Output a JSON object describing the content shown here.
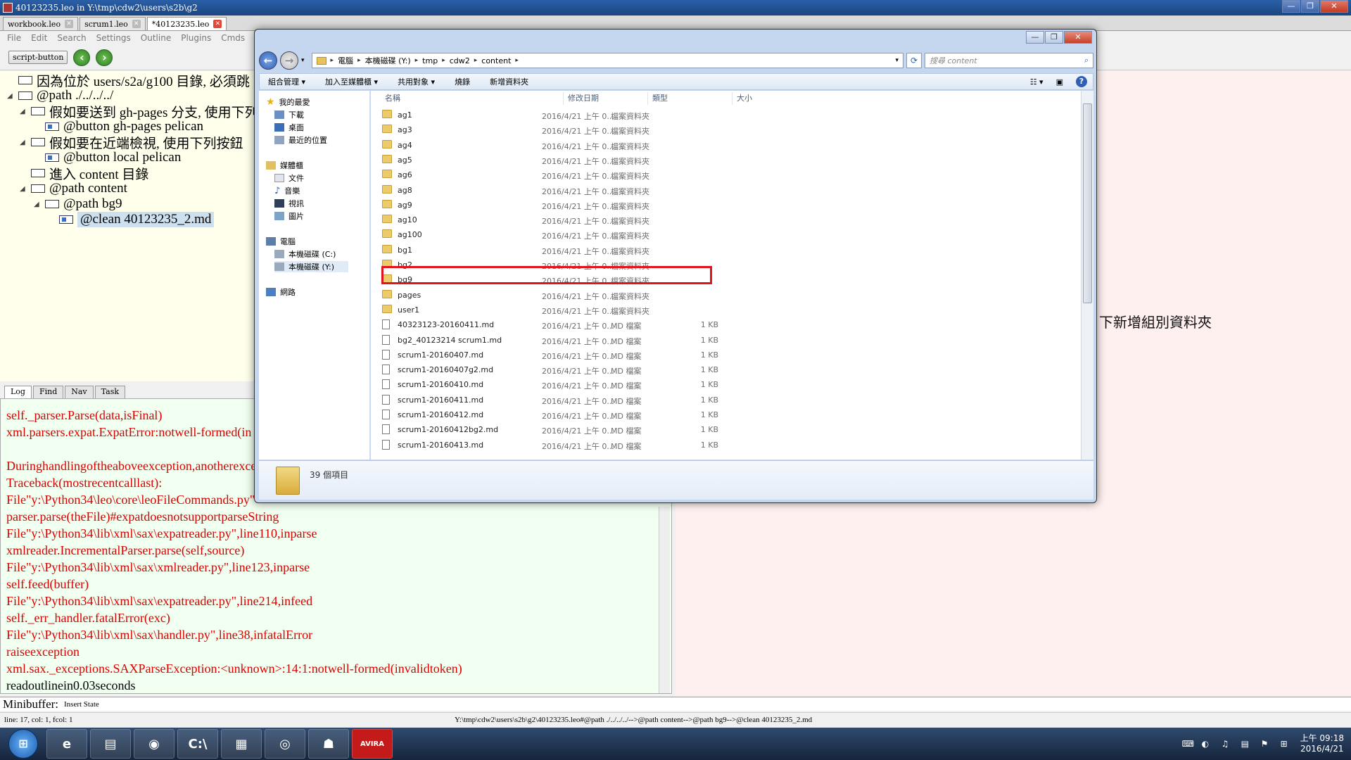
{
  "leo": {
    "title": "40123235.leo in Y:\\tmp\\cdw2\\users\\s2b\\g2",
    "tabs": [
      {
        "label": "workbook.leo",
        "close": "✕"
      },
      {
        "label": "scrum1.leo",
        "close": "✕"
      },
      {
        "label": "*40123235.leo",
        "close": "✕"
      }
    ],
    "menu": [
      "File",
      "Edit",
      "Search",
      "Settings",
      "Outline",
      "Plugins",
      "Cmds"
    ],
    "script_button": "script-button",
    "outline": [
      "因為位於 users/s2a/g100 目錄, 必須跳",
      "@path ./../../../",
      "假如要送到 gh-pages 分支, 使用下列",
      "@button gh-pages pelican",
      "假如要在近端檢視, 使用下列按鈕",
      "@button local pelican",
      "進入 content 目錄",
      "@path content",
      "@path bg9",
      "@clean 40123235_2.md"
    ],
    "body_text": "下新增組別資料夾",
    "log_tabs": [
      "Log",
      "Find",
      "Nav",
      "Task"
    ],
    "log_lines": [
      "self._parser.Parse(data,isFinal)",
      "xml.parsers.expat.ExpatError:notwell-formed(in",
      "Duringhandlingoftheaboveexception,anotherexce",
      "Traceback(mostrecentcalllast):",
      "File\"y:\\Python34\\leo\\core\\leoFileCommands.py\"",
      "parser.parse(theFile)#expatdoesnotsupportparseString",
      "File\"y:\\Python34\\lib\\xml\\sax\\expatreader.py\",line110,inparse",
      "xmlreader.IncrementalParser.parse(self,source)",
      "File\"y:\\Python34\\lib\\xml\\sax\\xmlreader.py\",line123,inparse",
      "self.feed(buffer)",
      "File\"y:\\Python34\\lib\\xml\\sax\\expatreader.py\",line214,infeed",
      "self._err_handler.fatalError(exc)",
      "File\"y:\\Python34\\lib\\xml\\sax\\handler.py\",line38,infatalError",
      "raiseexception",
      "xml.sax._exceptions.SAXParseException:<unknown>:14:1:notwell-formed(invalidtoken)",
      "readoutlinein0.03seconds"
    ],
    "minibuffer_label": "Minibuffer:",
    "minibuffer_state": "Insert State",
    "status_left": "line: 17, col: 1, fcol: 1",
    "status_right": "Y:\\tmp\\cdw2\\users\\s2b\\g2\\40123235.leo#@path ./../../../-->@path content-->@path bg9-->@clean 40123235_2.md"
  },
  "explorer": {
    "address": [
      "電腦",
      "本機磁碟 (Y:)",
      "tmp",
      "cdw2",
      "content"
    ],
    "search_placeholder": "搜尋 content",
    "commands": [
      "組合管理 ▾",
      "加入至媒體櫃 ▾",
      "共用對象 ▾",
      "燒錄",
      "新增資料夾"
    ],
    "nav": {
      "favorites": "我的最愛",
      "downloads": "下載",
      "desktop": "桌面",
      "recent": "最近的位置",
      "libraries": "媒體櫃",
      "documents": "文件",
      "music": "音樂",
      "videos": "視訊",
      "pictures": "圖片",
      "computer": "電腦",
      "drive_c": "本機磁碟 (C:)",
      "drive_y": "本機磁碟 (Y:)",
      "network": "網路"
    },
    "columns": {
      "name": "名稱",
      "modified": "修改日期",
      "type": "類型",
      "size": "大小"
    },
    "rows": [
      {
        "name": "ag1",
        "date": "2016/4/21 上午 0...",
        "type": "檔案資料夾",
        "size": "",
        "kind": "folder"
      },
      {
        "name": "ag3",
        "date": "2016/4/21 上午 0...",
        "type": "檔案資料夾",
        "size": "",
        "kind": "folder"
      },
      {
        "name": "ag4",
        "date": "2016/4/21 上午 0...",
        "type": "檔案資料夾",
        "size": "",
        "kind": "folder"
      },
      {
        "name": "ag5",
        "date": "2016/4/21 上午 0...",
        "type": "檔案資料夾",
        "size": "",
        "kind": "folder"
      },
      {
        "name": "ag6",
        "date": "2016/4/21 上午 0...",
        "type": "檔案資料夾",
        "size": "",
        "kind": "folder"
      },
      {
        "name": "ag8",
        "date": "2016/4/21 上午 0...",
        "type": "檔案資料夾",
        "size": "",
        "kind": "folder"
      },
      {
        "name": "ag9",
        "date": "2016/4/21 上午 0...",
        "type": "檔案資料夾",
        "size": "",
        "kind": "folder"
      },
      {
        "name": "ag10",
        "date": "2016/4/21 上午 0...",
        "type": "檔案資料夾",
        "size": "",
        "kind": "folder"
      },
      {
        "name": "ag100",
        "date": "2016/4/21 上午 0...",
        "type": "檔案資料夾",
        "size": "",
        "kind": "folder"
      },
      {
        "name": "bg1",
        "date": "2016/4/21 上午 0...",
        "type": "檔案資料夾",
        "size": "",
        "kind": "folder"
      },
      {
        "name": "bg2",
        "date": "2016/4/21 上午 0...",
        "type": "檔案資料夾",
        "size": "",
        "kind": "folder"
      },
      {
        "name": "bg9",
        "date": "2016/4/21 上午 0...",
        "type": "檔案資料夾",
        "size": "",
        "kind": "folder"
      },
      {
        "name": "pages",
        "date": "2016/4/21 上午 0...",
        "type": "檔案資料夾",
        "size": "",
        "kind": "folder"
      },
      {
        "name": "user1",
        "date": "2016/4/21 上午 0...",
        "type": "檔案資料夾",
        "size": "",
        "kind": "folder"
      },
      {
        "name": "40323123-20160411.md",
        "date": "2016/4/21 上午 0...",
        "type": "MD 檔案",
        "size": "1 KB",
        "kind": "file"
      },
      {
        "name": "bg2_40123214 scrum1.md",
        "date": "2016/4/21 上午 0...",
        "type": "MD 檔案",
        "size": "1 KB",
        "kind": "file"
      },
      {
        "name": "scrum1-20160407.md",
        "date": "2016/4/21 上午 0...",
        "type": "MD 檔案",
        "size": "1 KB",
        "kind": "file"
      },
      {
        "name": "scrum1-20160407g2.md",
        "date": "2016/4/21 上午 0...",
        "type": "MD 檔案",
        "size": "1 KB",
        "kind": "file"
      },
      {
        "name": "scrum1-20160410.md",
        "date": "2016/4/21 上午 0...",
        "type": "MD 檔案",
        "size": "1 KB",
        "kind": "file"
      },
      {
        "name": "scrum1-20160411.md",
        "date": "2016/4/21 上午 0...",
        "type": "MD 檔案",
        "size": "1 KB",
        "kind": "file"
      },
      {
        "name": "scrum1-20160412.md",
        "date": "2016/4/21 上午 0...",
        "type": "MD 檔案",
        "size": "1 KB",
        "kind": "file"
      },
      {
        "name": "scrum1-20160412bg2.md",
        "date": "2016/4/21 上午 0...",
        "type": "MD 檔案",
        "size": "1 KB",
        "kind": "file"
      },
      {
        "name": "scrum1-20160413.md",
        "date": "2016/4/21 上午 0...",
        "type": "MD 檔案",
        "size": "1 KB",
        "kind": "file"
      }
    ],
    "item_count": "39 個項目"
  },
  "taskbar": {
    "start": "⊞",
    "items": [
      "e",
      "▤",
      "◉",
      "C:\\",
      "▦",
      "◎",
      "☗",
      "AVIRA"
    ],
    "time": "上午 09:18",
    "date": "2016/4/21"
  },
  "colors": {
    "highlight": "#e0141c",
    "log_text": "#dd0000",
    "outline_bg": "#ffffec"
  }
}
